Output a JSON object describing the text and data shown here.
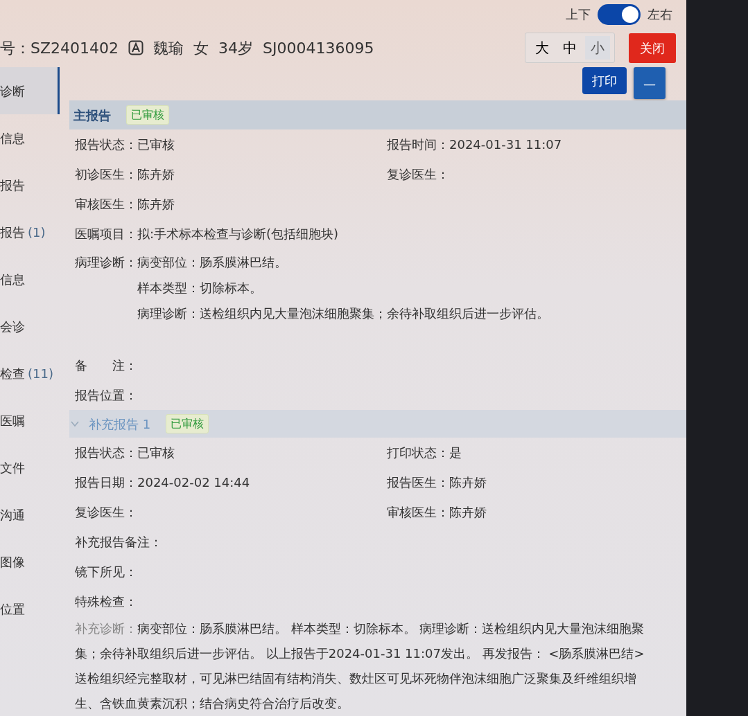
{
  "layout_toggle": {
    "left_label": "上下",
    "right_label": "左右",
    "on": true
  },
  "patient": {
    "record_no": "号：SZ2401402",
    "name": "魏瑜",
    "sex": "女",
    "age": "34岁",
    "id": "SJ0004136095"
  },
  "font_sizes": [
    {
      "label": "大",
      "selected": false
    },
    {
      "label": "中",
      "selected": false
    },
    {
      "label": "小",
      "selected": true
    }
  ],
  "close_button": "关闭",
  "print_button": "打印",
  "collapse_button": "—",
  "sidebar": [
    {
      "label": "诊断",
      "selected": true
    },
    {
      "label": "信息",
      "selected": false
    },
    {
      "label": "报告",
      "selected": false
    },
    {
      "label": "报告",
      "count": "(1)",
      "selected": false
    },
    {
      "label": "信息",
      "selected": false
    },
    {
      "label": "会诊",
      "selected": false
    },
    {
      "label": "检查",
      "count": "(11)",
      "selected": false
    },
    {
      "label": "医嘱",
      "selected": false
    },
    {
      "label": "文件",
      "selected": false
    },
    {
      "label": "沟通",
      "selected": false
    },
    {
      "label": "图像",
      "selected": false
    },
    {
      "label": "位置",
      "selected": false
    }
  ],
  "main_report": {
    "title": "主报告",
    "status_badge": "已审核",
    "rows": [
      [
        {
          "label": "报告状态：",
          "value": "已审核"
        },
        {
          "label": "报告时间：",
          "value": "2024-01-31 11:07"
        }
      ],
      [
        {
          "label": "初诊医生：",
          "value": "陈卉娇"
        },
        {
          "label": "复诊医生："
        }
      ],
      [
        {
          "label": "审核医生：",
          "value": "陈卉娇"
        }
      ],
      [
        {
          "label": "医嘱项目：",
          "value": "拟:手术标本检查与诊断(包括细胞块)"
        }
      ],
      [
        {
          "label": "病理诊断：",
          "lines": [
            "病变部位：肠系膜淋巴结。",
            "样本类型：切除标本。",
            "病理诊断：送检组织内见大量泡沫细胞聚集；余待补取组织后进一步评估。"
          ]
        }
      ],
      [
        {
          "label": "备　　注："
        }
      ],
      [
        {
          "label": "报告位置："
        }
      ]
    ]
  },
  "supplement_report": {
    "title": "补充报告 1",
    "expanded": true,
    "status_badge": "已审核",
    "rows": [
      [
        {
          "label": "报告状态：",
          "value": "已审核"
        },
        {
          "label": "打印状态：",
          "value": "是"
        }
      ],
      [
        {
          "label": "报告日期：",
          "value": "2024-02-02 14:44"
        },
        {
          "label": "报告医生：",
          "value": "陈卉娇"
        }
      ],
      [
        {
          "label": "复诊医生："
        },
        {
          "label": "审核医生：",
          "value": "陈卉娇"
        }
      ],
      [
        {
          "label": "补充报告备注："
        }
      ],
      [
        {
          "label": "镜下所见："
        }
      ],
      [
        {
          "label": "特殊检查："
        }
      ]
    ],
    "diagnosis": {
      "label": "补充诊断：",
      "text": "病变部位：肠系膜淋巴结。 样本类型：切除标本。 病理诊断：送检组织内见大量泡沫细胞聚集；余待补取组织后进一步评估。 以上报告于2024-01-31 11:07发出。 再发报告： <肠系膜淋巴结>送检组织经完整取材，可见淋巴结固有结构消失、数灶区可见坏死物伴泡沫细胞广泛聚集及纤维组织增生、含铁血黄素沉积；结合病史符合治疗后改变。"
    }
  }
}
